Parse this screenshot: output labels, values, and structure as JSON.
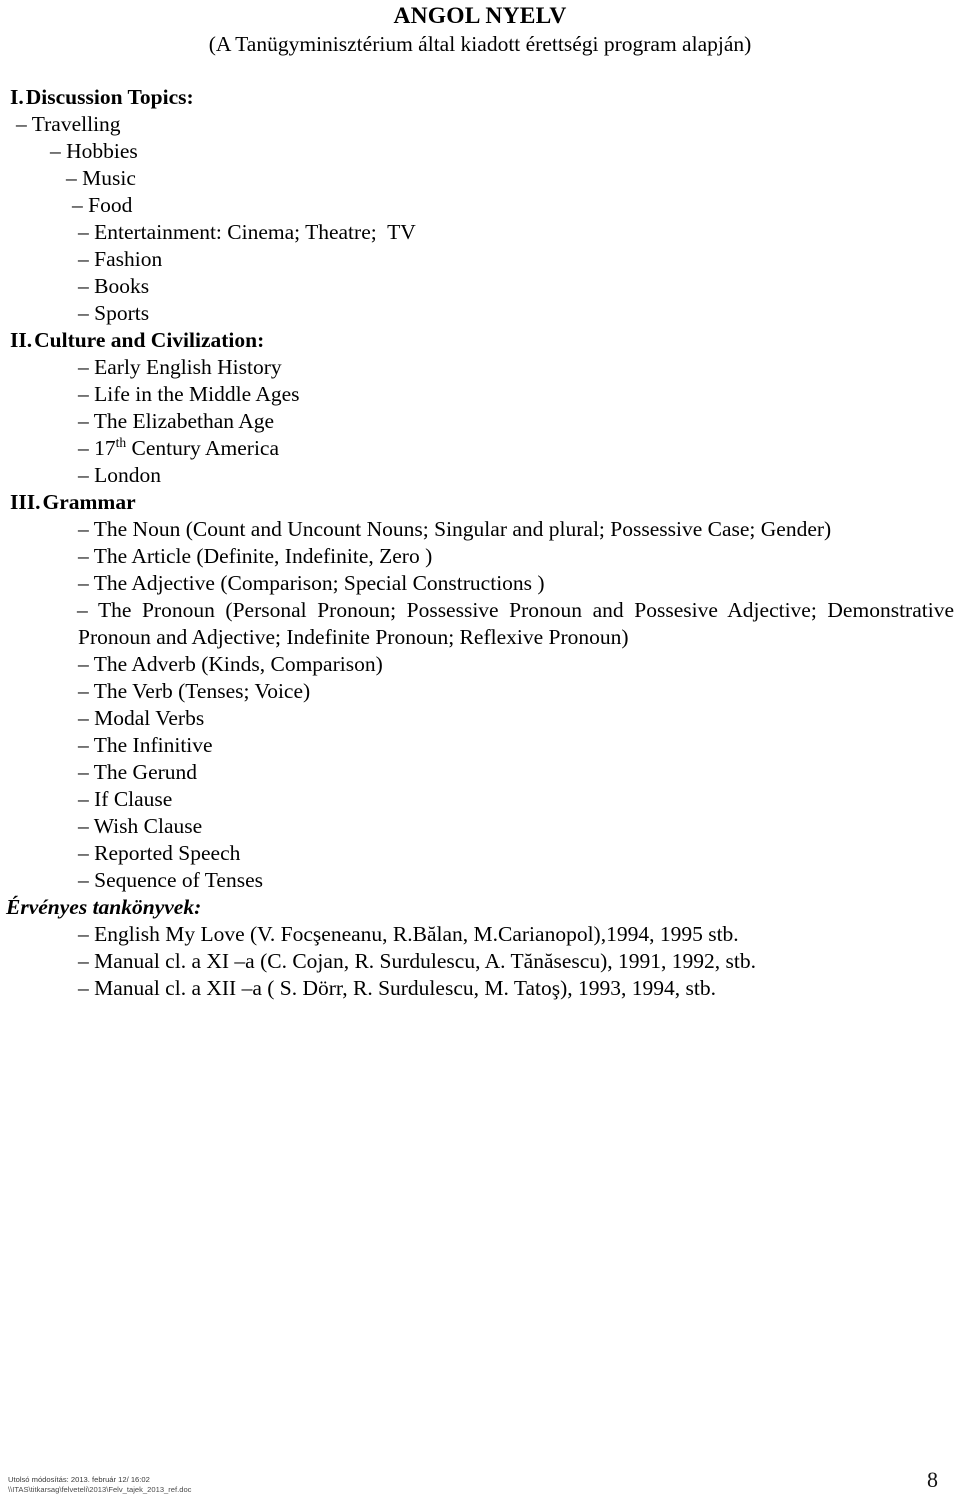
{
  "header": {
    "title": "ANGOL NYELV",
    "subtitle": "(A Tanügyminisztérium által kiadott érettségi program alapján)"
  },
  "sections": [
    {
      "numeral": "I.",
      "heading": "Discussion Topics:",
      "items": [
        {
          "dash": "– ",
          "text": "Travelling",
          "indent": "ind-0"
        },
        {
          "dash": "– ",
          "text": "Hobbies",
          "indent": "ind-1"
        },
        {
          "dash": "– ",
          "text": "Music",
          "indent": "ind-2"
        },
        {
          "dash": "– ",
          "text": "Food",
          "indent": "ind-3"
        },
        {
          "dash": "– ",
          "text": "Entertainment: Cinema; Theatre;  TV",
          "indent": "ind-std"
        },
        {
          "dash": "– ",
          "text": "Fashion",
          "indent": "ind-std"
        },
        {
          "dash": "– ",
          "text": "Books",
          "indent": "ind-std"
        },
        {
          "dash": "– ",
          "text": "Sports",
          "indent": "ind-std"
        }
      ]
    },
    {
      "numeral": "II.",
      "heading": "Culture and Civilization:",
      "items": [
        {
          "dash": "– ",
          "text": "Early English History",
          "indent": "ind-std"
        },
        {
          "dash": "– ",
          "text": "Life in the Middle Ages",
          "indent": "ind-std"
        },
        {
          "dash": "– ",
          "text": "The Elizabethan Age",
          "indent": "ind-std"
        },
        {
          "dash": "– ",
          "text": "17",
          "sup": "th",
          "text_after": " Century America",
          "indent": "ind-std"
        },
        {
          "dash": "– ",
          "text": "London",
          "indent": "ind-std"
        }
      ]
    },
    {
      "numeral": "III.",
      "heading": "Grammar",
      "items": [
        {
          "dash": "– ",
          "text": "The Noun (Count and Uncount Nouns; Singular and plural; Possessive Case; Gender)",
          "indent": "ind-std"
        },
        {
          "dash": "– ",
          "text": "The Article (Definite, Indefinite, Zero )",
          "indent": "ind-std"
        },
        {
          "dash": "– ",
          "text": "The Adjective (Comparison; Special Constructions )",
          "indent": "ind-std"
        }
      ],
      "justified_item": {
        "dash": "– ",
        "text": "The Pronoun (Personal Pronoun; Possessive Pronoun and Possesive Adjective; Demonstrative Pronoun and Adjective; Indefinite Pronoun; Reflexive Pronoun)"
      },
      "items_after": [
        {
          "dash": "– ",
          "text": "The Adverb (Kinds, Comparison)",
          "indent": "ind-std"
        },
        {
          "dash": "– ",
          "text": "The Verb (Tenses; Voice)",
          "indent": "ind-std"
        },
        {
          "dash": "– ",
          "text": "Modal Verbs",
          "indent": "ind-std"
        },
        {
          "dash": "– ",
          "text": "The Infinitive",
          "indent": "ind-std"
        },
        {
          "dash": "– ",
          "text": "The Gerund",
          "indent": "ind-std"
        },
        {
          "dash": "– ",
          "text": "If Clause",
          "indent": "ind-std"
        },
        {
          "dash": "– ",
          "text": "Wish Clause",
          "indent": "ind-std"
        },
        {
          "dash": "– ",
          "text": "Reported Speech",
          "indent": "ind-std"
        },
        {
          "dash": "– ",
          "text": "Sequence of Tenses",
          "indent": "ind-std"
        }
      ]
    }
  ],
  "books": {
    "heading": "Érvényes tankönyvek:",
    "items": [
      {
        "dash": "– ",
        "text": "English My Love (V. Focşeneanu, R.Bălan, M.Carianopol),1994, 1995 stb."
      },
      {
        "dash": "– ",
        "text": "Manual cl. a XI –a (C. Cojan, R. Surdulescu, A. Tănăsescu), 1991, 1992, stb."
      },
      {
        "dash": "– ",
        "text": "Manual cl. a XII –a ( S. Dörr, R. Surdulescu, M. Tatoş), 1993, 1994, stb."
      }
    ]
  },
  "footer": {
    "modified_label": "Utolsó módosítás: 2013. február 12/ 16:02",
    "file_path": "\\\\ITAS\\titkarsag\\felveteli\\2013\\Felv_tajek_2013_ref.doc",
    "page_number": "8"
  }
}
